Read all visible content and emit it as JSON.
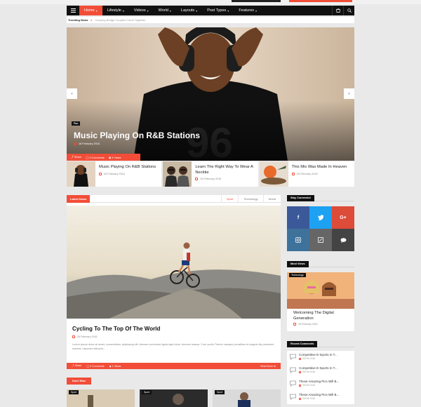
{
  "nav": {
    "items": [
      {
        "label": "Home",
        "active": true
      },
      {
        "label": "Lifestyle"
      },
      {
        "label": "Videos"
      },
      {
        "label": "World"
      },
      {
        "label": "Layouts"
      },
      {
        "label": "Post Types"
      },
      {
        "label": "Features"
      }
    ],
    "right_icons": [
      "cart-icon",
      "search-icon"
    ]
  },
  "trending": {
    "label": "Trending News",
    "text": "Carrying Bridge Couples Come Together"
  },
  "hero": {
    "category": "Fun",
    "title": "Music Playing On R&B Stations",
    "date": "16 February 2016",
    "share": "Share",
    "comments": "3 Comments",
    "views": "4 Views"
  },
  "thumbs": [
    {
      "title": "Music Playing On R&B Stations",
      "date": "26 February 2016"
    },
    {
      "title": "Learn The Right Way To Wear A Necktie",
      "date": "26 February 2016"
    },
    {
      "title": "This Mix Was Made In Heaven",
      "date": "26 February 2016"
    }
  ],
  "latest": {
    "label": "Latest News",
    "tabs": [
      "Sport",
      "Technology",
      "World"
    ],
    "active_tab": "Sport",
    "title": "Cycling To The Top Of The World",
    "date": "26 February 2016",
    "excerpt": "Lorem ipsum dolor sit amet, consectetuer adipiscing elit. Aenean commodo ligula eget dolor. Aenean massa. Cum sociis Theme natoque penatibus et magnis dis parturient montes, nascetur ridiculus...",
    "share": "Share",
    "comments": "0 Comments",
    "views": "1 Views",
    "read_more": "Read More"
  },
  "dont_miss": {
    "label": "Don't Miss",
    "tags": [
      "Sport",
      "Sport",
      "Sport"
    ]
  },
  "sidebar": {
    "stay_connected": "Stay Connected",
    "social": [
      {
        "name": "facebook",
        "glyph": "f",
        "color": "#3b5998"
      },
      {
        "name": "twitter",
        "glyph": "t",
        "color": "#1da1f2"
      },
      {
        "name": "google-plus",
        "glyph": "G+",
        "color": "#dd4b39"
      },
      {
        "name": "instagram",
        "glyph": "◎",
        "color": "#3f729b"
      },
      {
        "name": "blog",
        "glyph": "✎",
        "color": "#666666"
      },
      {
        "name": "chat",
        "glyph": "●",
        "color": "#444444"
      }
    ],
    "most_views": "Most Views",
    "mv_tag": "Technology",
    "mv_title": "Welcoming The Digital Generation",
    "mv_date": "16 February 2016",
    "recent_comments": "Recent Comments",
    "comments": [
      {
        "title": "Competitive E-Sports In T...",
        "date": "26 Feb 2016"
      },
      {
        "title": "Competitive E-Sports In T...",
        "date": "26 Feb 2016"
      },
      {
        "title": "These Amazing Pics Will B...",
        "date": "26 Feb 2016"
      },
      {
        "title": "These Amazing Pics Will B...",
        "date": "26 Feb 2016"
      }
    ]
  },
  "colors": {
    "accent": "#f24d38",
    "nav_bg": "#111111"
  }
}
